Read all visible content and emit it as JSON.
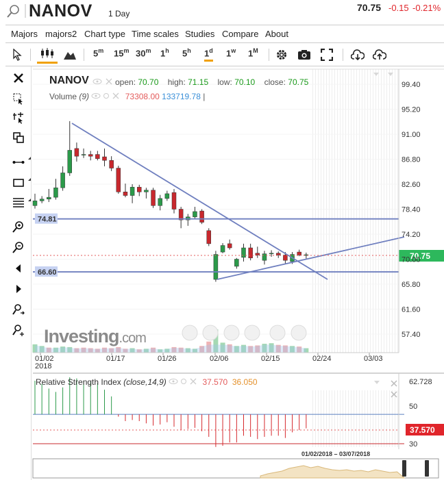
{
  "header": {
    "ticker": "NANOV",
    "period": "1 Day",
    "price": "70.75",
    "change": "-0.15",
    "change_pct": "-0.21%"
  },
  "menu": [
    "Majors",
    "majors2",
    "Chart type",
    "Time scales",
    "Studies",
    "Compare",
    "About"
  ],
  "toolbar": {
    "timeframes": [
      "5",
      "15",
      "30",
      "1",
      "5",
      "1",
      "1",
      "1"
    ],
    "timeframe_units": [
      "m",
      "m",
      "m",
      "h",
      "h",
      "d",
      "w",
      "M"
    ],
    "active_index": 5
  },
  "legend": {
    "symbol": "NANOV",
    "open_label": "open:",
    "open": "70.70",
    "high_label": "high:",
    "high": "71.15",
    "low_label": "low:",
    "low": "70.10",
    "close_label": "close:",
    "close": "70.75",
    "volume_label": "Volume",
    "volume_param": "(9)",
    "volume_v1": "73308.00",
    "volume_v2": "133719.78",
    "rsi_label": "Relative Strength Index",
    "rsi_params": "(close,14,9)",
    "rsi_v1": "37.570",
    "rsi_v2": "36.050"
  },
  "branding": {
    "logo_main": "Investing",
    "logo_suffix": ".com"
  },
  "chart_data": {
    "type": "candlestick",
    "y_ticks": [
      "99.40",
      "95.20",
      "91.00",
      "86.80",
      "82.60",
      "78.40",
      "74.20",
      "70.00",
      "65.80",
      "61.60",
      "57.40"
    ],
    "x_ticks": [
      "01/02",
      "01/17",
      "01/26",
      "02/06",
      "02/15",
      "02/24",
      "03/03"
    ],
    "x_year": "2018",
    "price_tag": "70.75",
    "hlines": [
      {
        "label": "74.81",
        "value": 74.81
      },
      {
        "label": "66.60",
        "value": 66.6
      }
    ],
    "candles": [
      {
        "o": 79.0,
        "h": 81.0,
        "l": 78.5,
        "c": 79.8
      },
      {
        "o": 79.8,
        "h": 80.6,
        "l": 79.4,
        "c": 80.1
      },
      {
        "o": 80.1,
        "h": 81.8,
        "l": 79.6,
        "c": 80.4
      },
      {
        "o": 80.4,
        "h": 83.5,
        "l": 80.0,
        "c": 82.0
      },
      {
        "o": 82.0,
        "h": 85.6,
        "l": 81.5,
        "c": 84.5
      },
      {
        "o": 84.5,
        "h": 93.2,
        "l": 84.0,
        "c": 88.3
      },
      {
        "o": 88.6,
        "h": 89.6,
        "l": 86.4,
        "c": 87.3
      },
      {
        "o": 87.6,
        "h": 88.6,
        "l": 87.0,
        "c": 87.6
      },
      {
        "o": 87.6,
        "h": 88.2,
        "l": 86.6,
        "c": 87.3
      },
      {
        "o": 87.6,
        "h": 88.2,
        "l": 86.6,
        "c": 86.9
      },
      {
        "o": 87.2,
        "h": 88.6,
        "l": 85.6,
        "c": 86.6
      },
      {
        "o": 86.6,
        "h": 87.3,
        "l": 84.8,
        "c": 85.3
      },
      {
        "o": 85.3,
        "h": 85.7,
        "l": 81.0,
        "c": 81.3
      },
      {
        "o": 81.3,
        "h": 82.7,
        "l": 80.4,
        "c": 80.7
      },
      {
        "o": 80.7,
        "h": 82.6,
        "l": 79.4,
        "c": 82.1
      },
      {
        "o": 82.1,
        "h": 82.5,
        "l": 80.6,
        "c": 81.3
      },
      {
        "o": 81.3,
        "h": 82.0,
        "l": 80.2,
        "c": 81.6
      },
      {
        "o": 81.6,
        "h": 82.0,
        "l": 78.6,
        "c": 79.0
      },
      {
        "o": 79.0,
        "h": 80.8,
        "l": 78.2,
        "c": 80.2
      },
      {
        "o": 80.2,
        "h": 81.5,
        "l": 79.8,
        "c": 81.0
      },
      {
        "o": 81.2,
        "h": 81.8,
        "l": 77.7,
        "c": 78.4
      },
      {
        "o": 78.4,
        "h": 78.8,
        "l": 75.2,
        "c": 76.6
      },
      {
        "o": 76.6,
        "h": 77.6,
        "l": 75.6,
        "c": 77.1
      },
      {
        "o": 77.1,
        "h": 78.8,
        "l": 76.8,
        "c": 78.0
      },
      {
        "o": 78.1,
        "h": 78.4,
        "l": 75.9,
        "c": 76.2
      },
      {
        "o": 74.8,
        "h": 75.2,
        "l": 72.2,
        "c": 72.6
      },
      {
        "o": 66.6,
        "h": 71.4,
        "l": 66.2,
        "c": 70.8
      },
      {
        "o": 71.2,
        "h": 72.7,
        "l": 71.0,
        "c": 72.3
      },
      {
        "o": 72.6,
        "h": 73.3,
        "l": 71.6,
        "c": 71.9
      },
      {
        "o": 68.8,
        "h": 70.2,
        "l": 68.4,
        "c": 70.0
      },
      {
        "o": 70.3,
        "h": 72.6,
        "l": 69.6,
        "c": 71.9
      },
      {
        "o": 71.9,
        "h": 72.6,
        "l": 69.8,
        "c": 70.2
      },
      {
        "o": 71.0,
        "h": 72.1,
        "l": 70.2,
        "c": 70.7
      },
      {
        "o": 69.8,
        "h": 71.4,
        "l": 69.1,
        "c": 70.9
      },
      {
        "o": 70.9,
        "h": 71.5,
        "l": 70.4,
        "c": 71.0
      },
      {
        "o": 71.0,
        "h": 71.3,
        "l": 70.2,
        "c": 70.7
      },
      {
        "o": 70.7,
        "h": 71.2,
        "l": 69.3,
        "c": 69.8
      },
      {
        "o": 69.6,
        "h": 71.2,
        "l": 69.2,
        "c": 70.8
      },
      {
        "o": 71.2,
        "h": 71.6,
        "l": 70.5,
        "c": 70.7
      },
      {
        "o": 70.7,
        "h": 71.1,
        "l": 70.1,
        "c": 70.75
      }
    ],
    "volume": [
      15,
      12,
      9,
      9,
      11,
      10,
      8,
      9,
      8,
      7,
      9,
      8,
      10,
      7,
      8,
      6,
      7,
      9,
      6,
      7,
      10,
      9,
      8,
      7,
      12,
      20,
      42,
      18,
      15,
      12,
      14,
      12,
      13,
      16,
      17,
      14,
      13,
      12,
      11,
      8
    ],
    "volume_colors": [
      "g",
      "g",
      "r",
      "g",
      "g",
      "g",
      "r",
      "r",
      "r",
      "r",
      "r",
      "r",
      "r",
      "r",
      "g",
      "r",
      "g",
      "r",
      "g",
      "g",
      "r",
      "r",
      "g",
      "g",
      "r",
      "r",
      "g",
      "g",
      "r",
      "g",
      "g",
      "r",
      "r",
      "g",
      "g",
      "r",
      "r",
      "g",
      "r",
      "g"
    ],
    "rsi_y_ticks": [
      "62.728",
      "50",
      "30"
    ],
    "rsi_tag": "37.570",
    "rsi": [
      80,
      77,
      73,
      70,
      74,
      83,
      82,
      80,
      79,
      78,
      72,
      66,
      48,
      44,
      45,
      44,
      42,
      40,
      41,
      43,
      39,
      36,
      37,
      38,
      35,
      30,
      21,
      22,
      25,
      25,
      31,
      30,
      28,
      30,
      31,
      31,
      29,
      34,
      36,
      37.57
    ],
    "rsi_ylim": [
      19,
      69
    ],
    "ylim": [
      55,
      101
    ],
    "navigator_range": "01/02/2018 – 03/07/2018"
  },
  "colors": {
    "up": "#2b9a4a",
    "down": "#c8282d",
    "line": "#6f7fbf",
    "price_tag": "#2db85c",
    "rsi_tag": "#e0252b"
  }
}
